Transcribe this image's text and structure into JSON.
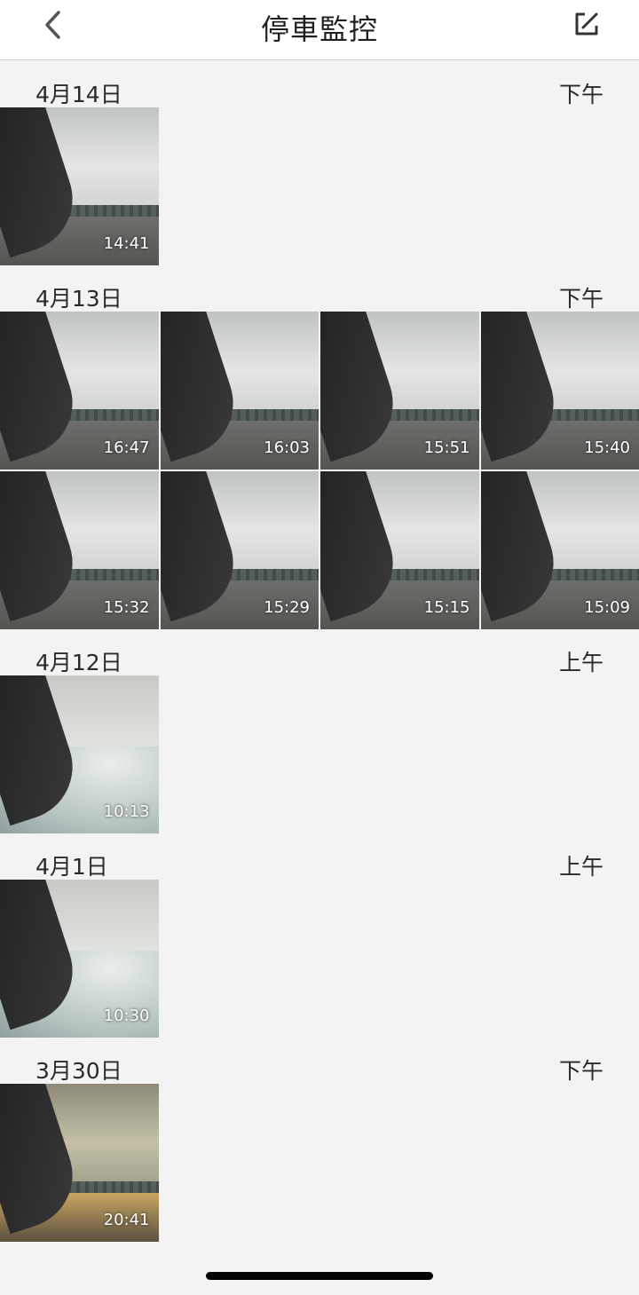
{
  "header": {
    "title": "停車監控",
    "back_icon": "chevron-left-icon",
    "edit_icon": "edit-square-icon"
  },
  "sections": [
    {
      "date": "4月14日",
      "period": "下午",
      "items": [
        {
          "time": "14:41",
          "style": "road"
        }
      ]
    },
    {
      "date": "4月13日",
      "period": "下午",
      "items": [
        {
          "time": "16:47",
          "style": "road"
        },
        {
          "time": "16:03",
          "style": "road"
        },
        {
          "time": "15:51",
          "style": "road"
        },
        {
          "time": "15:40",
          "style": "road"
        },
        {
          "time": "15:32",
          "style": "road"
        },
        {
          "time": "15:29",
          "style": "road"
        },
        {
          "time": "15:15",
          "style": "road"
        },
        {
          "time": "15:09",
          "style": "road"
        }
      ]
    },
    {
      "date": "4月12日",
      "period": "上午",
      "items": [
        {
          "time": "10:13",
          "style": "garage"
        }
      ]
    },
    {
      "date": "4月1日",
      "period": "上午",
      "items": [
        {
          "time": "10:30",
          "style": "garage"
        }
      ]
    },
    {
      "date": "3月30日",
      "period": "下午",
      "items": [
        {
          "time": "20:41",
          "style": "warm"
        }
      ]
    }
  ],
  "colors": {
    "background": "#f3f3f3",
    "header_background": "#ffffff",
    "text": "#2a2a2a",
    "home_indicator": "#000000"
  }
}
